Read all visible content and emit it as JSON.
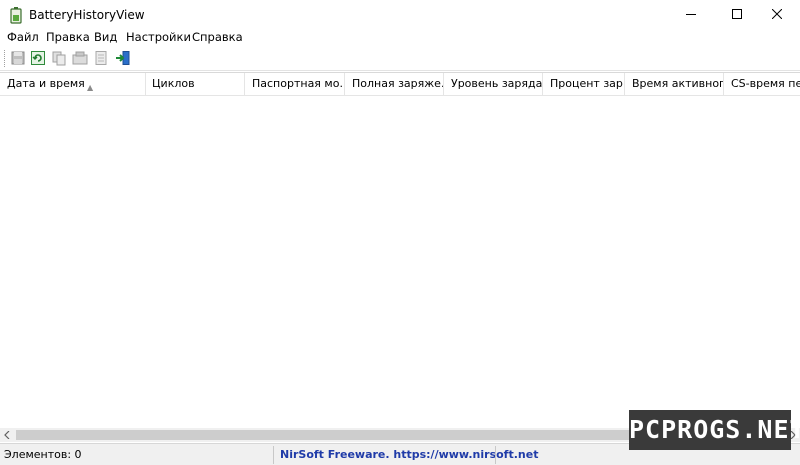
{
  "window": {
    "title": "BatteryHistoryView"
  },
  "menu": [
    {
      "label": "Файл"
    },
    {
      "label": "Правка"
    },
    {
      "label": "Вид"
    },
    {
      "label": "Настройки"
    },
    {
      "label": "Справка"
    }
  ],
  "toolbar": {
    "buttons": [
      "save-icon",
      "refresh-icon",
      "copy-icon",
      "properties-icon",
      "html-report-icon",
      "exit-icon"
    ]
  },
  "columns": [
    {
      "label": "Дата и время"
    },
    {
      "label": "Циклов"
    },
    {
      "label": "Паспортная мо..."
    },
    {
      "label": "Полная заряже..."
    },
    {
      "label": "Уровень заряда"
    },
    {
      "label": "Процент зар..."
    },
    {
      "label": "Время активног..."
    },
    {
      "label": "CS-время пер"
    }
  ],
  "status": {
    "items": "Элементов: 0",
    "link": "NirSoft Freeware. https://www.nirsoft.net"
  },
  "watermark": "PCPROGS.NET",
  "colors": {
    "link": "#1f3ba8",
    "watermark_bg": "#3a3a3a"
  }
}
